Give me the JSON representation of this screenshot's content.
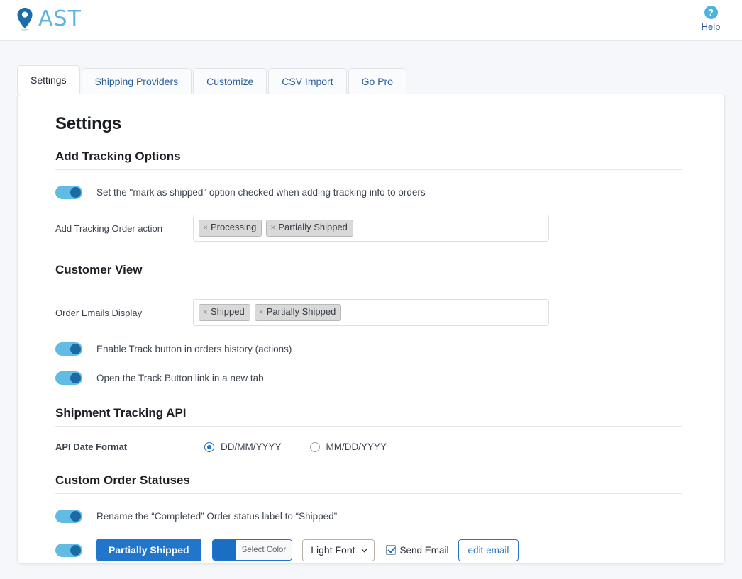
{
  "header": {
    "logo_text": "AST",
    "logo_icon": "map-pin-icon",
    "help_icon": "question-mark-icon",
    "help_label": "Help"
  },
  "tabs": [
    {
      "label": "Settings",
      "active": true
    },
    {
      "label": "Shipping Providers",
      "active": false
    },
    {
      "label": "Customize",
      "active": false
    },
    {
      "label": "CSV Import",
      "active": false
    },
    {
      "label": "Go Pro",
      "active": false
    }
  ],
  "page": {
    "title": "Settings"
  },
  "sections": {
    "add_tracking_options": {
      "title": "Add Tracking Options",
      "mark_as_shipped_toggle": {
        "label": "Set the \"mark as shipped\" option checked when adding tracking info to orders",
        "state": "on"
      },
      "order_action": {
        "label": "Add Tracking Order action",
        "tags": [
          "Processing",
          "Partially Shipped"
        ],
        "remove_glyph": "×"
      }
    },
    "customer_view": {
      "title": "Customer View",
      "order_emails_display": {
        "label": "Order Emails Display",
        "tags": [
          "Shipped",
          "Partially Shipped"
        ],
        "remove_glyph": "×"
      },
      "enable_track_button": {
        "label": "Enable Track button in orders history (actions)",
        "state": "on"
      },
      "open_new_tab": {
        "label": "Open the Track Button link in a new tab",
        "state": "on"
      }
    },
    "shipment_tracking_api": {
      "title": "Shipment Tracking API",
      "date_format": {
        "label": "API Date Format",
        "options": [
          {
            "label": "DD/MM/YYYY",
            "selected": true
          },
          {
            "label": "MM/DD/YYYY",
            "selected": false
          }
        ]
      }
    },
    "custom_order_statuses": {
      "title": "Custom Order Statuses",
      "rename_completed": {
        "label": "Rename the “Completed” Order status label to “Shipped”",
        "state": "on"
      },
      "status_row": {
        "toggle_state": "on",
        "status_button_label": "Partially Shipped",
        "color_picker_label": "Select Color",
        "color_value": "#1a6fc4",
        "font_select_value": "Light Font",
        "send_email_label": "Send Email",
        "send_email_checked": true,
        "edit_email_label": "edit email"
      }
    }
  },
  "colors": {
    "page_background": "#f5f7fa",
    "accent_blue": "#2176cb",
    "link_blue": "#2a5d9e",
    "toggle_track": "#61bbe2",
    "toggle_knob": "#1a6ba5",
    "logo_blue": "#5cb4e0",
    "tag_grey": "#d9d9d9"
  }
}
